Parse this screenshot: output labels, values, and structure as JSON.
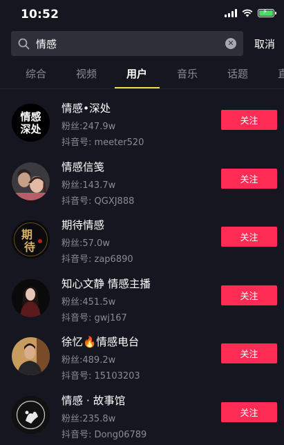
{
  "status_bar": {
    "time": "10:52"
  },
  "search": {
    "query": "情感",
    "cancel_label": "取消"
  },
  "tabs": [
    {
      "label": "综合"
    },
    {
      "label": "视频"
    },
    {
      "label": "用户",
      "active": true
    },
    {
      "label": "音乐"
    },
    {
      "label": "话题"
    },
    {
      "label": "直"
    }
  ],
  "colors": {
    "accent": "#fe2c55",
    "tab_indicator": "#fadf44",
    "background": "#15161f"
  },
  "users": [
    {
      "name": "情感•深处",
      "fans": "粉丝:247.9w",
      "id": "抖音号: meeter520",
      "follow_label": "关注",
      "avatar_text": [
        "情感",
        "深处"
      ]
    },
    {
      "name": "情感信笺",
      "fans": "粉丝:143.7w",
      "id": "抖音号: QGXJ888",
      "follow_label": "关注"
    },
    {
      "name": "期待情感",
      "fans": "粉丝:57.0w",
      "id": "抖音号: zap6890",
      "follow_label": "关注",
      "avatar_text": [
        "期",
        "待"
      ]
    },
    {
      "name": "知心文静 情感主播",
      "fans": "粉丝:451.5w",
      "id": "抖音号: gwj167",
      "follow_label": "关注"
    },
    {
      "name": "徐忆🔥情感电台",
      "fans": "粉丝:489.2w",
      "id": "抖音号: 15103203",
      "follow_label": "关注"
    },
    {
      "name": "情感 · 故事馆",
      "fans": "粉丝:235.8w",
      "id": "抖音号: Dong06789",
      "follow_label": "关注"
    }
  ]
}
